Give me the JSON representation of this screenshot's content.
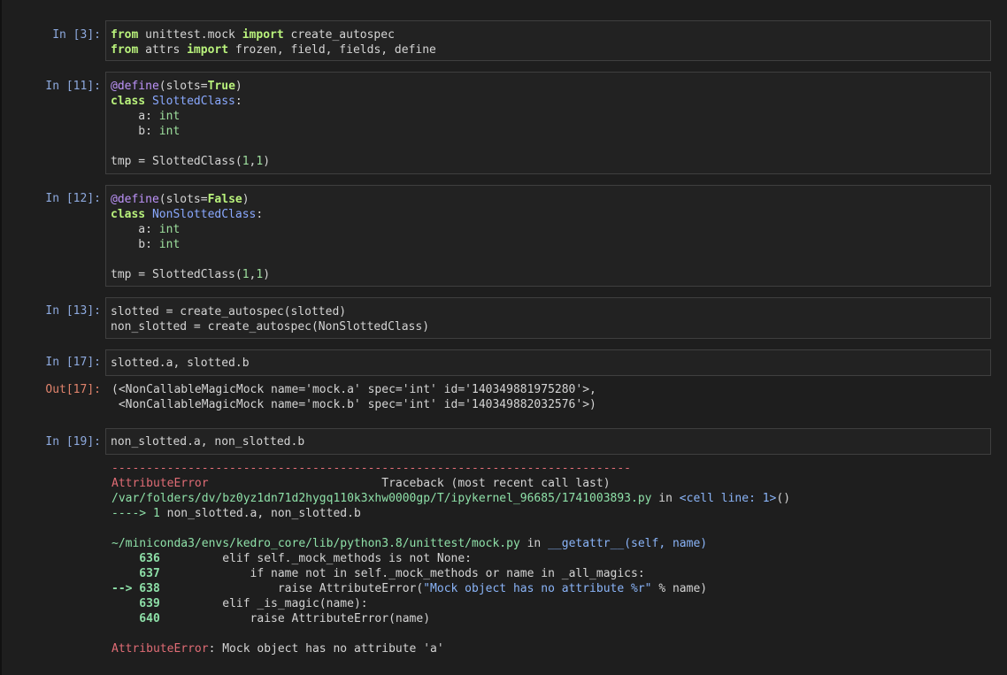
{
  "cells": [
    {
      "prompt": "In [3]:",
      "lines": [
        [
          "from",
          " unittest.mock ",
          "import",
          " create_autospec"
        ],
        [
          "from",
          " attrs ",
          "import",
          " frozen, field, fields, define"
        ]
      ]
    },
    {
      "prompt": "In [11]:",
      "lines": [
        [
          "@define",
          "(slots=",
          "True",
          ")"
        ],
        [
          "class",
          " ",
          "SlottedClass",
          ":"
        ],
        [
          "    a: ",
          "int"
        ],
        [
          "    b: ",
          "int"
        ],
        [
          ""
        ],
        [
          "tmp = SlottedClass(",
          "1",
          ",",
          "1",
          ")"
        ]
      ]
    },
    {
      "prompt": "In [12]:",
      "lines": [
        [
          "@define",
          "(slots=",
          "False",
          ")"
        ],
        [
          "class",
          " ",
          "NonSlottedClass",
          ":"
        ],
        [
          "    a: ",
          "int"
        ],
        [
          "    b: ",
          "int"
        ],
        [
          ""
        ],
        [
          "tmp = SlottedClass(",
          "1",
          ",",
          "1",
          ")"
        ]
      ]
    },
    {
      "prompt": "In [13]:",
      "lines": [
        [
          "slotted = create_autospec(slotted)"
        ],
        [
          "non_slotted = create_autospec(NonSlottedClass)"
        ]
      ]
    },
    {
      "prompt": "In [17]:",
      "lines": [
        [
          "slotted.a, slotted.b"
        ]
      ]
    },
    {
      "prompt": "In [19]:",
      "lines": [
        [
          "non_slotted.a, non_slotted.b"
        ]
      ]
    }
  ],
  "output17": {
    "prompt": "Out[17]:",
    "lines": [
      "(<NonCallableMagicMock name='mock.a' spec='int' id='140349881975280'>,",
      " <NonCallableMagicMock name='mock.b' spec='int' id='140349882032576'>)"
    ]
  },
  "traceback": {
    "separator": "---------------------------------------------------------------------------",
    "error_name": "AttributeError",
    "traceback_label": "                         Traceback (most recent call last)",
    "file_path": "/var/folders/dv/bz0yz1dn71d2hygq110k3xhw0000gp/T/ipykernel_96685/1741003893.py",
    "in_word": " in ",
    "cell_line": "<cell line: 1>",
    "parens": "()",
    "arrow1": "----> 1",
    "arrow1_code": " non_slotted.a, non_slotted.b",
    "mock_path": "~/miniconda3/envs/kedro_core/lib/python3.8/unittest/mock.py",
    "mock_func": "__getattr__",
    "mock_args": "(self, name)",
    "frame_lines": [
      {
        "num": "    636",
        "code": "         elif self._mock_methods is not None:"
      },
      {
        "num": "    637",
        "code": "             if name not in self._mock_methods or name in _all_magics:"
      },
      {
        "num": "--> 638",
        "code": "                 raise AttributeError(",
        "str": "\"Mock object has no attribute %r\"",
        "tail": " % name)"
      },
      {
        "num": "    639",
        "code": "         elif _is_magic(name):"
      },
      {
        "num": "    640",
        "code": "             raise AttributeError(name)"
      }
    ],
    "final_error": "AttributeError",
    "final_message": ": Mock object has no attribute 'a'"
  }
}
